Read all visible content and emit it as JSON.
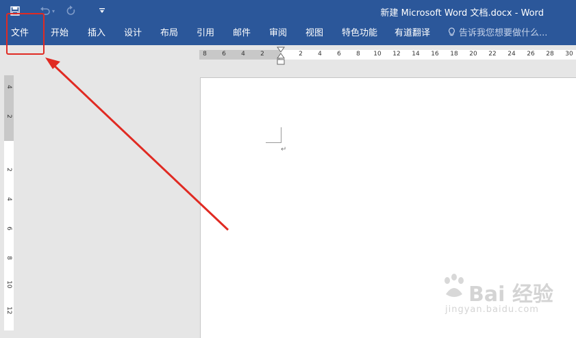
{
  "window": {
    "title": "新建 Microsoft Word 文档.docx - Word"
  },
  "qat": {
    "save_icon": "save-icon",
    "undo_icon": "undo-icon",
    "redo_icon": "redo-icon",
    "customize_icon": "customize-qat-icon"
  },
  "ribbon": {
    "tabs": [
      {
        "label": "文件"
      },
      {
        "label": "开始"
      },
      {
        "label": "插入"
      },
      {
        "label": "设计"
      },
      {
        "label": "布局"
      },
      {
        "label": "引用"
      },
      {
        "label": "邮件"
      },
      {
        "label": "审阅"
      },
      {
        "label": "视图"
      },
      {
        "label": "特色功能"
      },
      {
        "label": "有道翻译"
      }
    ],
    "tell_me": "告诉我您想要做什么..."
  },
  "hruler": {
    "labels": [
      "8",
      "6",
      "4",
      "2",
      "2",
      "4",
      "6",
      "8",
      "10",
      "12",
      "14",
      "16",
      "18",
      "20",
      "22",
      "24",
      "26",
      "28",
      "30"
    ]
  },
  "vruler": {
    "labels": [
      "4",
      "2",
      "2",
      "4",
      "6",
      "8",
      "10",
      "12"
    ]
  },
  "document": {
    "paragraph_mark": "↵"
  },
  "watermark": {
    "line1": "Bai 经验",
    "line2": "jingyan.baidu.com"
  },
  "annotation": {
    "color": "#e02a22"
  },
  "colors": {
    "ribbon": "#2b579a",
    "canvas": "#e6e6e6"
  }
}
